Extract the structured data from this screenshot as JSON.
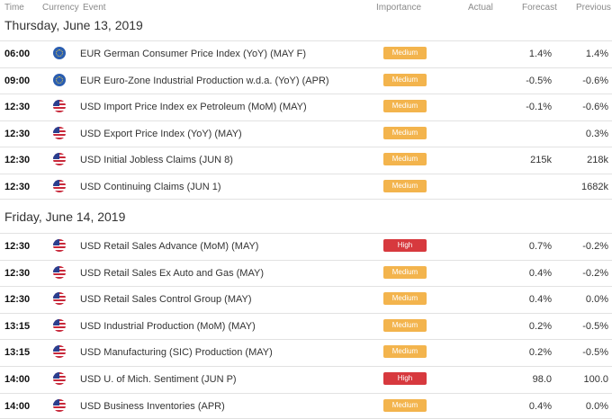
{
  "headers": {
    "time": "Time",
    "currency": "Currency",
    "event": "Event",
    "importance": "Importance",
    "actual": "Actual",
    "forecast": "Forecast",
    "previous": "Previous"
  },
  "colors": {
    "medium": "#f3b44d",
    "high": "#d7393e",
    "eur_flag": "#2a5db0",
    "usd_red": "#c8283a",
    "usd_blue": "#2b3f8f"
  },
  "days": [
    {
      "title": "Thursday, June 13, 2019",
      "events": [
        {
          "time": "06:00",
          "flag": "eu-flag-icon",
          "event": "EUR German Consumer Price Index (YoY) (MAY F)",
          "importance": "Medium",
          "actual": "",
          "forecast": "1.4%",
          "previous": "1.4%"
        },
        {
          "time": "09:00",
          "flag": "eu-flag-icon",
          "event": "EUR Euro-Zone Industrial Production w.d.a. (YoY) (APR)",
          "importance": "Medium",
          "actual": "",
          "forecast": "-0.5%",
          "previous": "-0.6%"
        },
        {
          "time": "12:30",
          "flag": "us-flag-icon",
          "event": "USD Import Price Index ex Petroleum (MoM) (MAY)",
          "importance": "Medium",
          "actual": "",
          "forecast": "-0.1%",
          "previous": "-0.6%"
        },
        {
          "time": "12:30",
          "flag": "us-flag-icon",
          "event": "USD Export Price Index (YoY) (MAY)",
          "importance": "Medium",
          "actual": "",
          "forecast": "",
          "previous": "0.3%"
        },
        {
          "time": "12:30",
          "flag": "us-flag-icon",
          "event": "USD Initial Jobless Claims (JUN 8)",
          "importance": "Medium",
          "actual": "",
          "forecast": "215k",
          "previous": "218k"
        },
        {
          "time": "12:30",
          "flag": "us-flag-icon",
          "event": "USD Continuing Claims (JUN 1)",
          "importance": "Medium",
          "actual": "",
          "forecast": "",
          "previous": "1682k"
        }
      ]
    },
    {
      "title": "Friday, June 14, 2019",
      "events": [
        {
          "time": "12:30",
          "flag": "us-flag-icon",
          "event": "USD Retail Sales Advance (MoM) (MAY)",
          "importance": "High",
          "actual": "",
          "forecast": "0.7%",
          "previous": "-0.2%"
        },
        {
          "time": "12:30",
          "flag": "us-flag-icon",
          "event": "USD Retail Sales Ex Auto and Gas (MAY)",
          "importance": "Medium",
          "actual": "",
          "forecast": "0.4%",
          "previous": "-0.2%"
        },
        {
          "time": "12:30",
          "flag": "us-flag-icon",
          "event": "USD Retail Sales Control Group (MAY)",
          "importance": "Medium",
          "actual": "",
          "forecast": "0.4%",
          "previous": "0.0%"
        },
        {
          "time": "13:15",
          "flag": "us-flag-icon",
          "event": "USD Industrial Production (MoM) (MAY)",
          "importance": "Medium",
          "actual": "",
          "forecast": "0.2%",
          "previous": "-0.5%"
        },
        {
          "time": "13:15",
          "flag": "us-flag-icon",
          "event": "USD Manufacturing (SIC) Production (MAY)",
          "importance": "Medium",
          "actual": "",
          "forecast": "0.2%",
          "previous": "-0.5%"
        },
        {
          "time": "14:00",
          "flag": "us-flag-icon",
          "event": "USD U. of Mich. Sentiment (JUN P)",
          "importance": "High",
          "actual": "",
          "forecast": "98.0",
          "previous": "100.0"
        },
        {
          "time": "14:00",
          "flag": "us-flag-icon",
          "event": "USD Business Inventories (APR)",
          "importance": "Medium",
          "actual": "",
          "forecast": "0.4%",
          "previous": "0.0%"
        }
      ]
    }
  ]
}
